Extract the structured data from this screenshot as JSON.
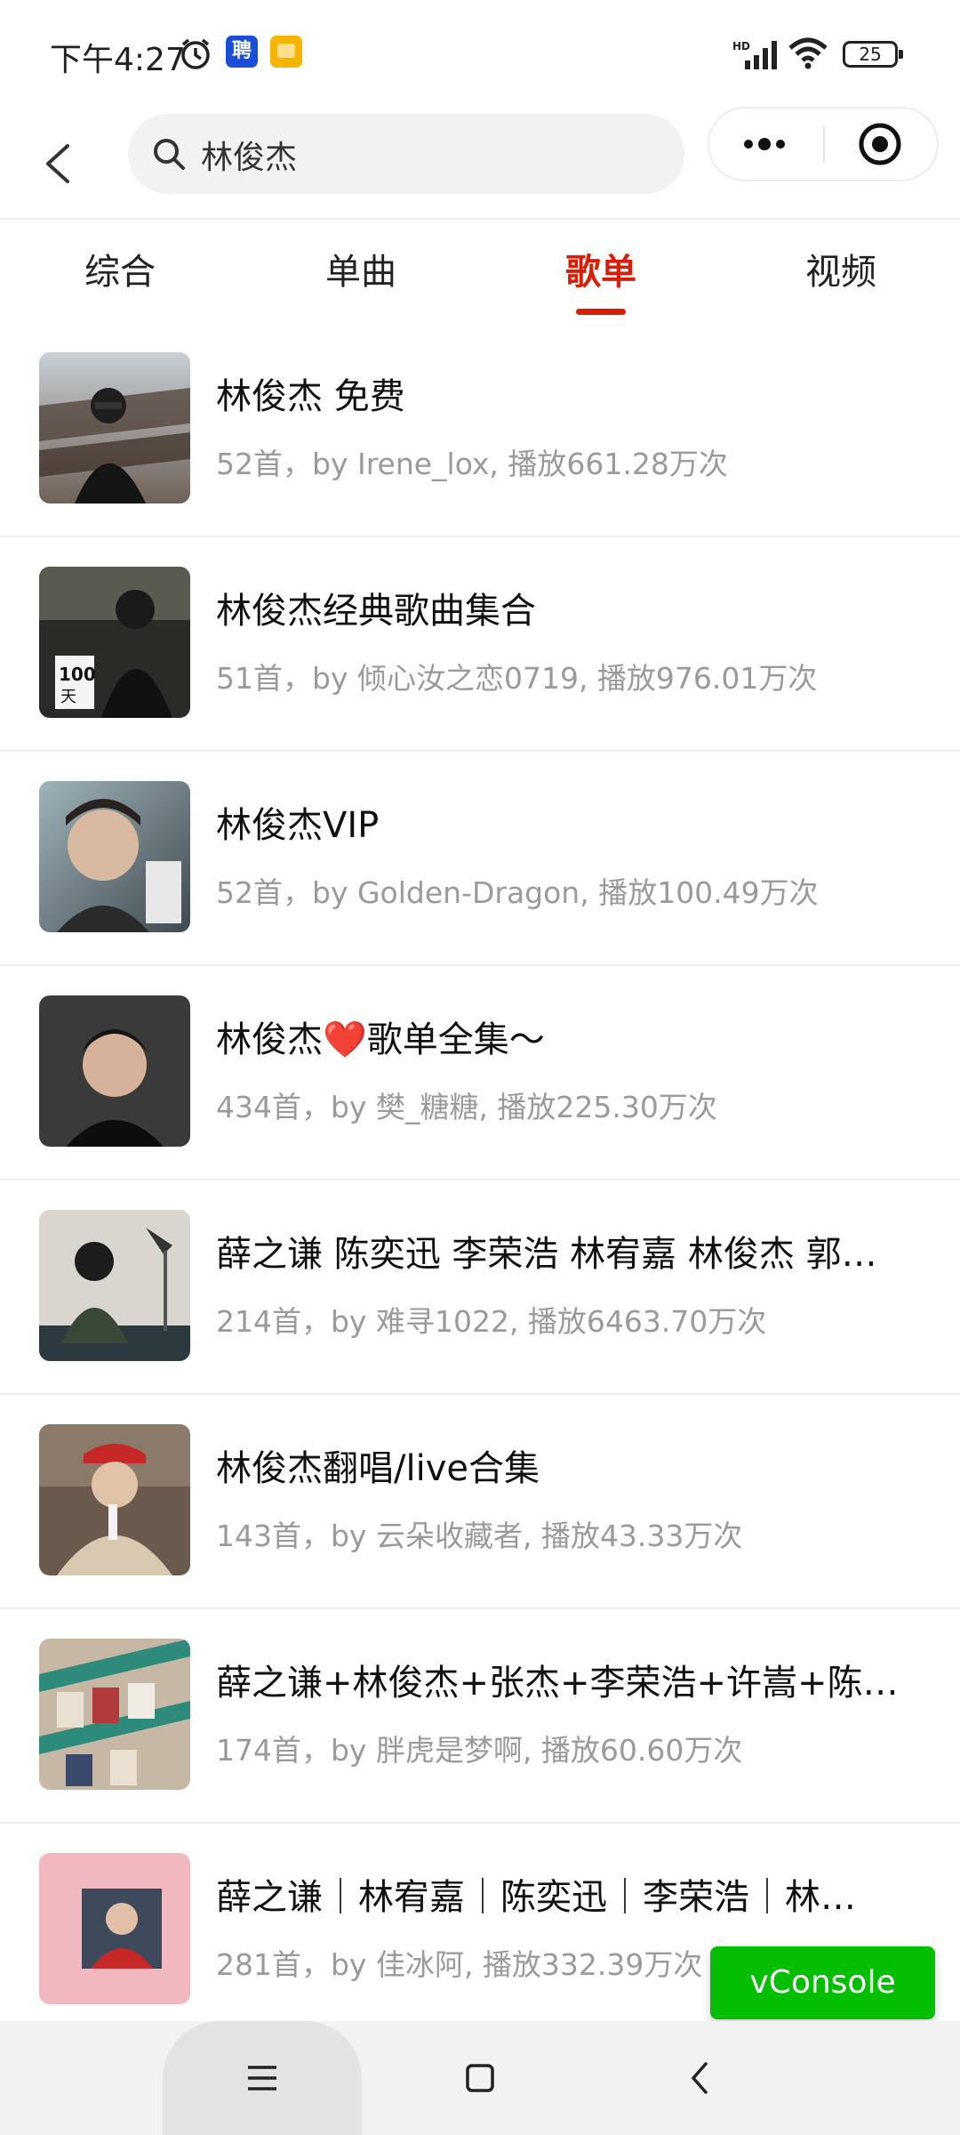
{
  "status_bar": {
    "time": "下午4:27",
    "battery": "25",
    "app_badge_label": "聘"
  },
  "search": {
    "value": "林俊杰",
    "placeholder": "林俊杰"
  },
  "tabs": [
    {
      "label": "综合",
      "active": false
    },
    {
      "label": "单曲",
      "active": false
    },
    {
      "label": "歌单",
      "active": true
    },
    {
      "label": "视频",
      "active": false
    }
  ],
  "playlists": [
    {
      "title": "林俊杰 免费",
      "subtitle": "52首，by Irene_lox, 播放661.28万次"
    },
    {
      "title": "林俊杰经典歌曲集合",
      "subtitle": "51首，by 倾心汝之恋0719, 播放976.01万次"
    },
    {
      "title": "林俊杰VIP",
      "subtitle": "52首，by Golden-Dragon, 播放100.49万次"
    },
    {
      "title": "林俊杰❤️歌单全集～",
      "subtitle": "434首，by 樊_糖糖, 播放225.30万次"
    },
    {
      "title": "薛之谦 陈奕迅 李荣浩 林宥嘉 林俊杰 郭…",
      "subtitle": "214首，by 难寻1022, 播放6463.70万次"
    },
    {
      "title": "林俊杰翻唱/live合集",
      "subtitle": "143首，by 云朵收藏者, 播放43.33万次"
    },
    {
      "title": "薛之谦+林俊杰+张杰+李荣浩+许嵩+陈…",
      "subtitle": "174首，by 胖虎是梦啊, 播放60.60万次"
    },
    {
      "title": "薛之谦｜林宥嘉｜陈奕迅｜李荣浩｜林…",
      "subtitle": "281首，by 佳冰阿, 播放332.39万次"
    }
  ],
  "vconsole": {
    "label": "vConsole"
  },
  "colors": {
    "accent": "#d81e06",
    "vconsole": "#04be02",
    "subtitle": "#9a9a9a"
  },
  "icons": {
    "back": "chevron-left-icon",
    "search": "search-icon",
    "more": "more-dots-icon",
    "close": "target-close-icon",
    "nav_menu": "menu-icon",
    "nav_home": "square-home-icon",
    "nav_back": "back-icon"
  }
}
